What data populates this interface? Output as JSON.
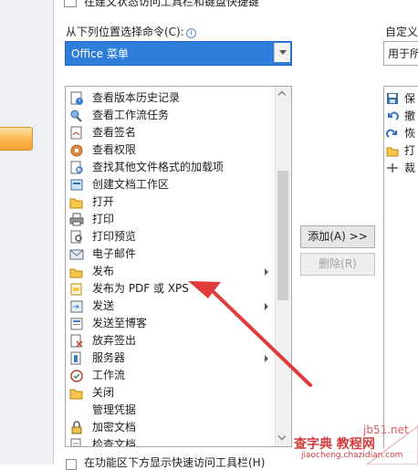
{
  "top_checkbox_label": "在建文状态访问工具栏和键盘快捷键",
  "choose_label": "从下列位置选择命令(C):",
  "choose_info_icon": "info-icon",
  "category_value": "Office 菜单",
  "right_label": "自定义快",
  "right_select_value": "用于所",
  "commands": [
    {
      "label": "查看版本历史记录",
      "icon": "version-history-icon",
      "submenu": false
    },
    {
      "label": "查看工作流任务",
      "icon": "workflow-task-icon",
      "submenu": false
    },
    {
      "label": "查看签名",
      "icon": "signature-icon",
      "submenu": false
    },
    {
      "label": "查看权限",
      "icon": "permission-icon",
      "submenu": false
    },
    {
      "label": "查找其他文件格式的加载项",
      "icon": "addin-search-icon",
      "submenu": false
    },
    {
      "label": "创建文档工作区",
      "icon": "document-workspace-icon",
      "submenu": false
    },
    {
      "label": "打开",
      "icon": "open-folder-icon",
      "submenu": false
    },
    {
      "label": "打印",
      "icon": "printer-icon",
      "submenu": false
    },
    {
      "label": "打印预览",
      "icon": "print-preview-icon",
      "submenu": false
    },
    {
      "label": "电子邮件",
      "icon": "email-icon",
      "submenu": false
    },
    {
      "label": "发布",
      "icon": "publish-icon",
      "submenu": true
    },
    {
      "label": "发布为 PDF 或 XPS",
      "icon": "pdf-xps-icon",
      "submenu": false
    },
    {
      "label": "发送",
      "icon": "send-icon",
      "submenu": true
    },
    {
      "label": "发送至博客",
      "icon": "blog-icon",
      "submenu": false
    },
    {
      "label": "放弃签出",
      "icon": "discard-checkout-icon",
      "submenu": false
    },
    {
      "label": "服务器",
      "icon": "server-icon",
      "submenu": true
    },
    {
      "label": "工作流",
      "icon": "workflow-icon",
      "submenu": false
    },
    {
      "label": "关闭",
      "icon": "close-folder-icon",
      "submenu": false
    },
    {
      "label": "管理凭据",
      "icon": "",
      "submenu": false
    },
    {
      "label": "加密文档",
      "icon": "encrypt-icon",
      "submenu": false
    },
    {
      "label": "检查文档",
      "icon": "inspect-icon",
      "submenu": false
    }
  ],
  "add_button": "添加(A) >>",
  "remove_button": "删除(R)",
  "right_items": [
    {
      "label": "保",
      "icon": "save-icon"
    },
    {
      "label": "撤",
      "icon": "undo-icon"
    },
    {
      "label": "恢",
      "icon": "redo-icon"
    },
    {
      "label": "打",
      "icon": "open-icon"
    },
    {
      "label": "裁",
      "icon": "separator-icon"
    }
  ],
  "bottom_checkbox_label": "在功能区下方显示快速访问工具栏(H)",
  "watermark": {
    "site": "jb51.net",
    "name": "查字典 教程网",
    "url": "jiaocheng.chazidian.com"
  },
  "colors": {
    "selection": "#2e7ddb",
    "annotation_arrow": "#e03c3c",
    "orange_tab": "#f9b64e"
  }
}
